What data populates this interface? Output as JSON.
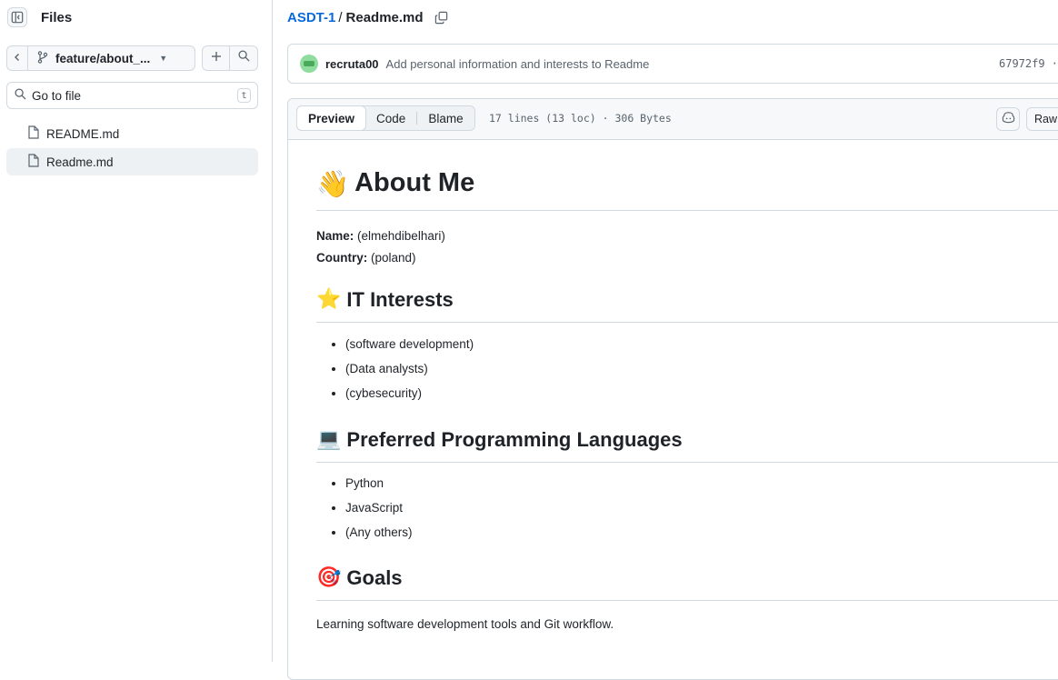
{
  "sidebar": {
    "title": "Files",
    "branch": "feature/about_...",
    "goto_placeholder": "Go to file",
    "goto_shortcut": "t",
    "files": [
      {
        "name": "README.md",
        "active": false
      },
      {
        "name": "Readme.md",
        "active": true
      }
    ],
    "icons": [
      "sidebar-collapse-icon",
      "chevron-left-icon",
      "git-branch-icon",
      "triangle-down-icon",
      "plus-icon",
      "search-icon",
      "file-icon"
    ]
  },
  "breadcrumb": {
    "repo": "ASDT-1",
    "separator": "/",
    "file": "Readme.md"
  },
  "commit": {
    "author": "recruta00",
    "message": "Add personal information and interests to Readme",
    "sha": "67972f9 ·"
  },
  "file_header": {
    "tabs": [
      "Preview",
      "Code",
      "Blame"
    ],
    "active_tab": "Preview",
    "meta": "17 lines (13 loc) · 306 Bytes",
    "raw_label": "Raw"
  },
  "readme": {
    "h1": {
      "emoji": "👋",
      "text": "About Me"
    },
    "name_label": "Name:",
    "name_value": "(elmehdibelhari)",
    "country_label": "Country:",
    "country_value": "(poland)",
    "interests": {
      "emoji": "⭐",
      "text": "IT Interests",
      "items": [
        "(software development)",
        "(Data analysts)",
        "(cybesecurity)"
      ]
    },
    "languages": {
      "emoji": "💻",
      "text": "Preferred Programming Languages",
      "items": [
        "Python",
        "JavaScript",
        "(Any others)"
      ]
    },
    "goals": {
      "emoji": "🎯",
      "text": "Goals",
      "body": "Learning software development tools and Git workflow."
    }
  },
  "colors": {
    "link": "#0969da",
    "border": "#d1d9e0",
    "muted": "#59636e",
    "active_bg": "#eef1f4"
  }
}
